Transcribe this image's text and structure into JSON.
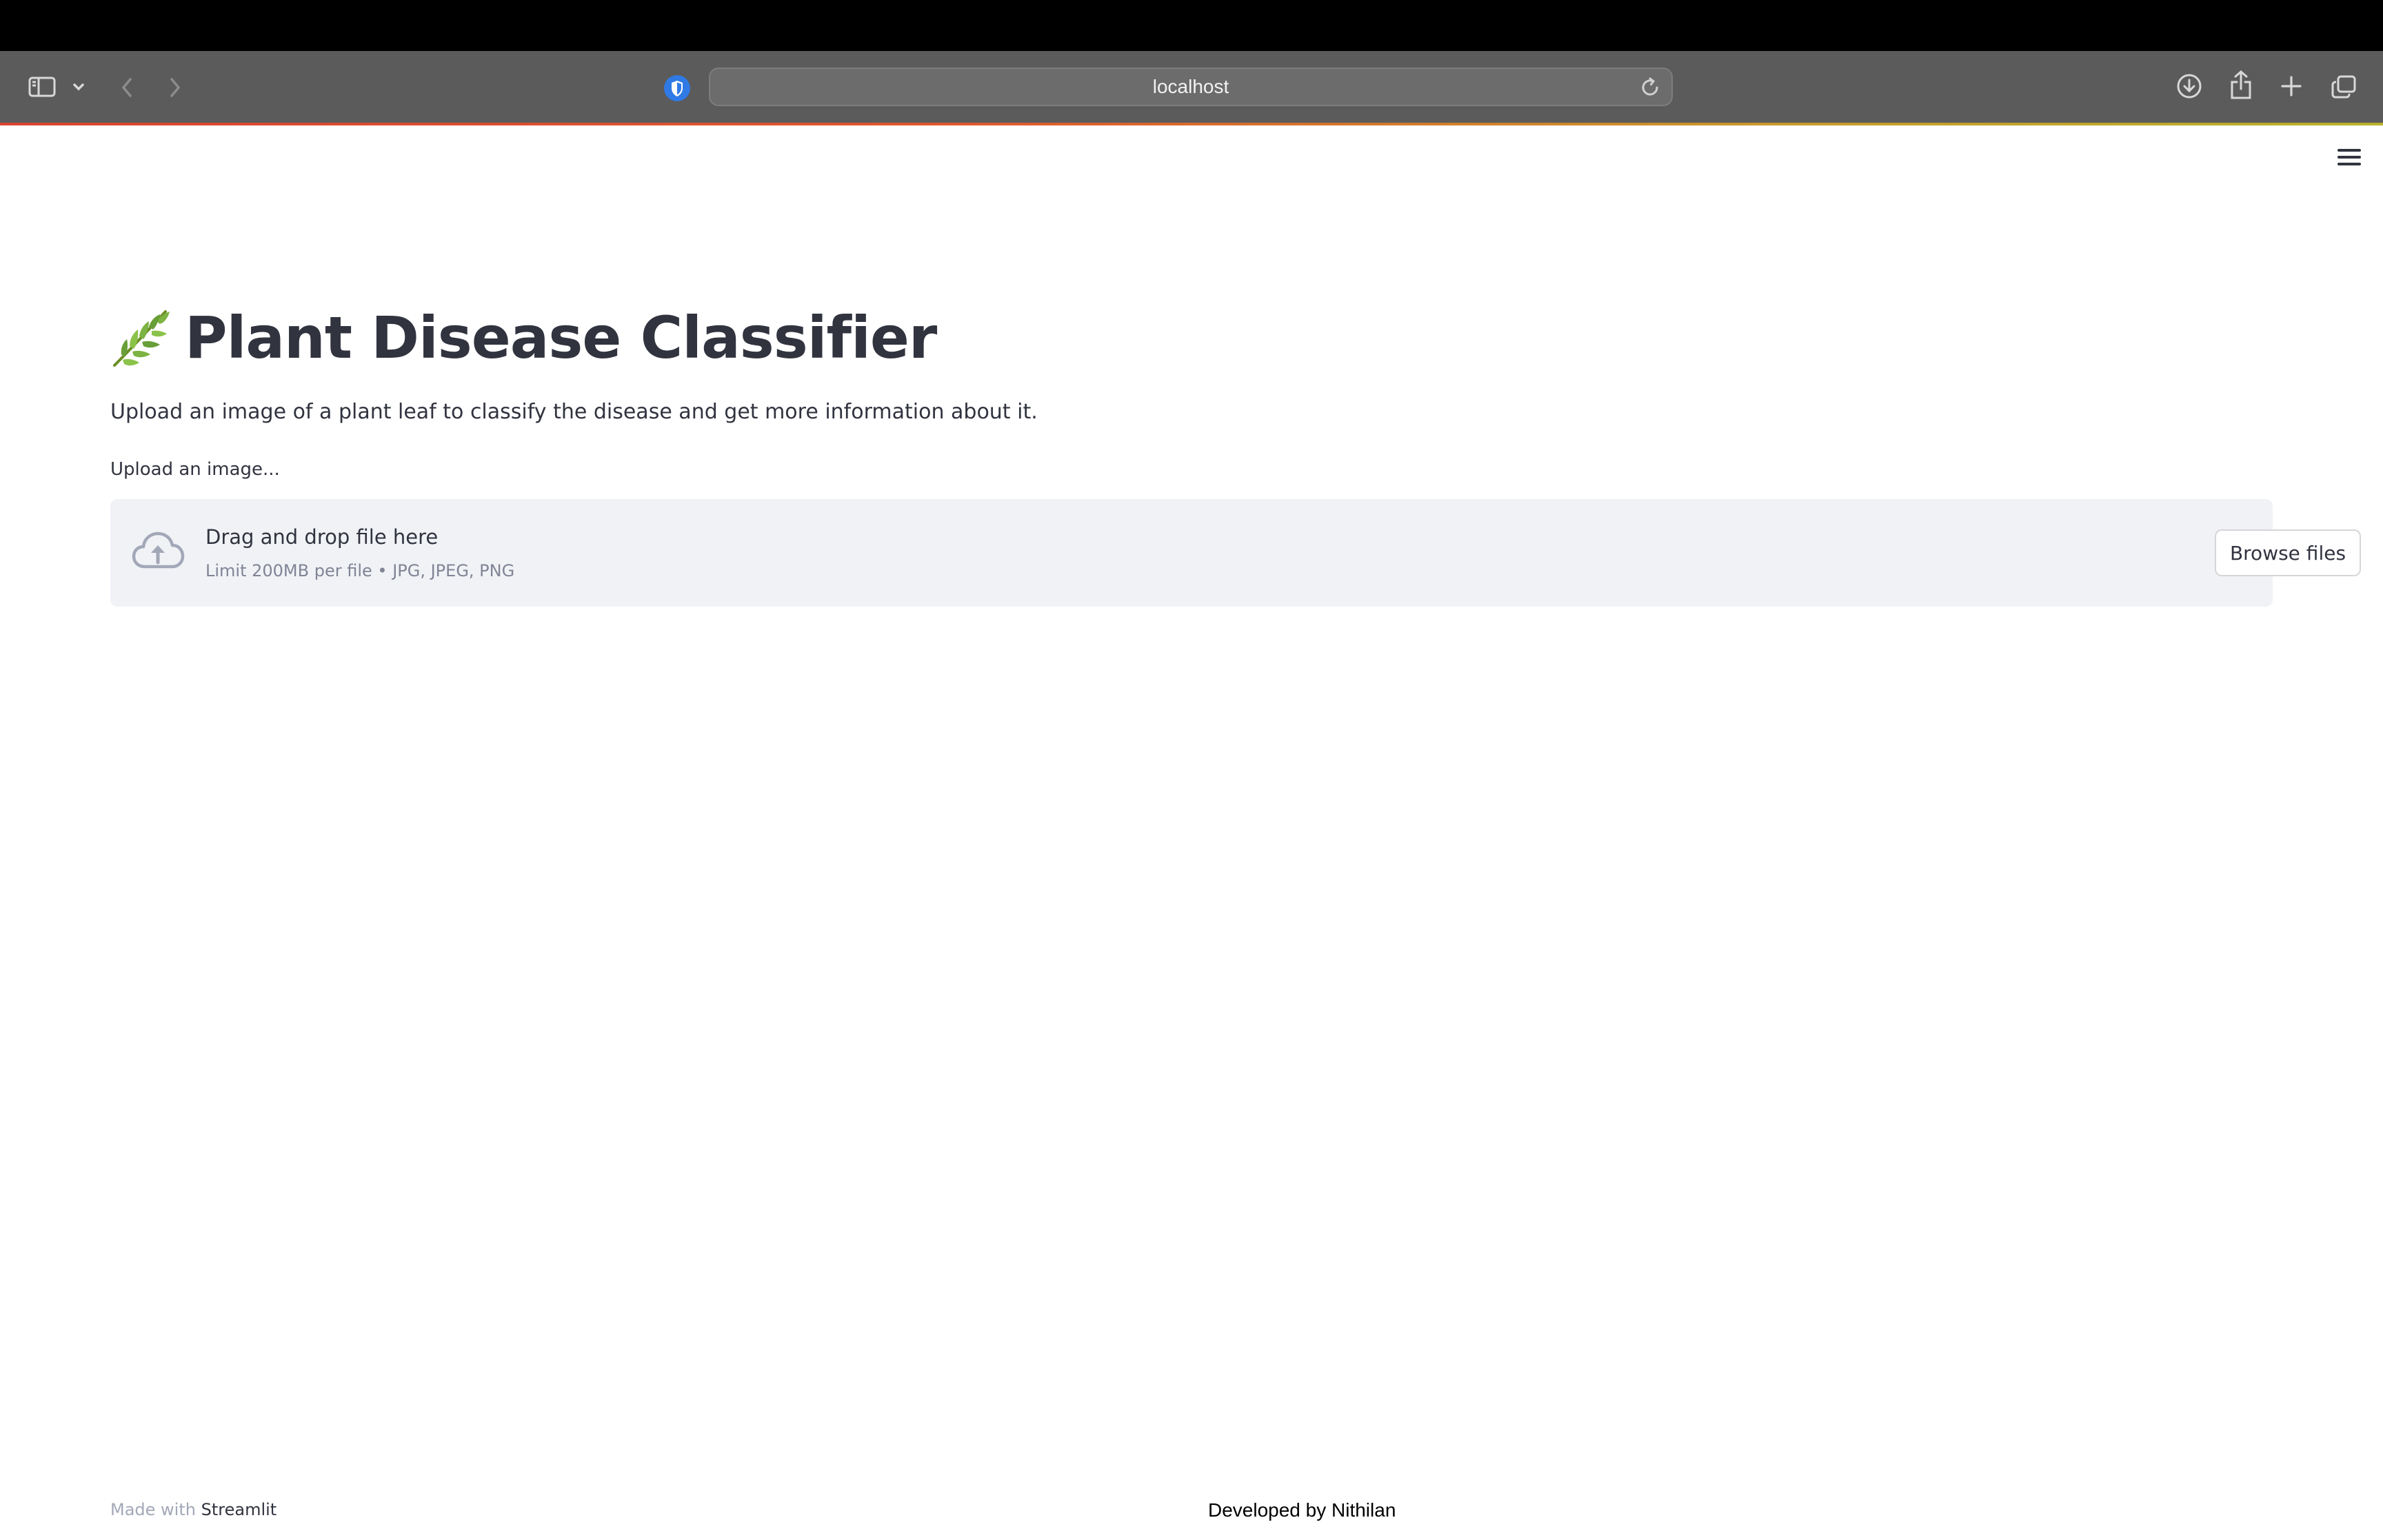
{
  "browser": {
    "address": "localhost",
    "icons": {
      "sidebar": "sidebar-icon",
      "sidebar_menu": "chevron-down-icon",
      "back": "chevron-left-icon",
      "forward": "chevron-right-icon",
      "privacy": "privacy-shield-icon",
      "reload": "reload-icon",
      "downloads": "download-icon",
      "share": "share-icon",
      "new_tab": "plus-icon",
      "tab_overview": "tabs-icon"
    },
    "progress_colors": [
      "#d9442f",
      "#c99a2a",
      "#b8b12a"
    ]
  },
  "app": {
    "title_emoji": "🌿",
    "title": "Plant Disease Classifier",
    "description": "Upload an image of a plant leaf to classify the disease and get more information about it.",
    "uploader": {
      "label": "Upload an image...",
      "drop_text": "Drag and drop file here",
      "limit_text": "Limit 200MB per file • JPG, JPEG, PNG",
      "button_label": "Browse files",
      "icon": "cloud-upload-icon"
    },
    "menu_icon": "hamburger-menu-icon"
  },
  "footer": {
    "made_with": "Made with",
    "brand": "Streamlit",
    "developer": "Developed by Nithilan"
  },
  "colors": {
    "text": "#31333f",
    "muted": "#808495",
    "dropzone_bg": "#f0f2f6",
    "toolbar_bg": "#5b5b5b"
  }
}
